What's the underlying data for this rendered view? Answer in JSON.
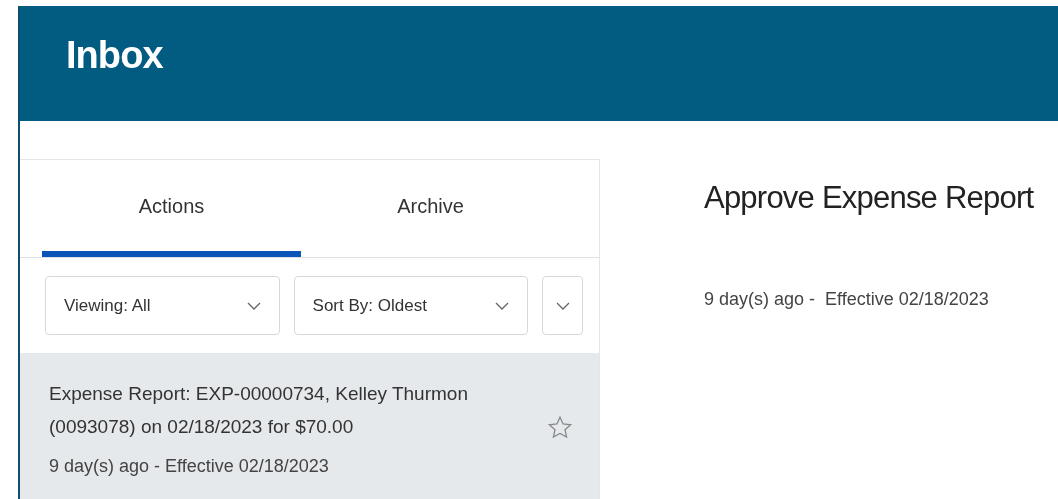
{
  "header": {
    "title": "Inbox"
  },
  "tabs": [
    {
      "label": "Actions",
      "selected": true
    },
    {
      "label": "Archive",
      "selected": false
    }
  ],
  "filters": [
    {
      "value": "Viewing: All"
    },
    {
      "value": "Sort By: Oldest"
    }
  ],
  "items": [
    {
      "title": "Expense Report: EXP-00000734, Kelley Thurmon (0093078) on 02/18/2023 for $70.00",
      "meta": "9 day(s) ago - Effective 02/18/2023",
      "selected": true,
      "starred": false
    }
  ],
  "detail": {
    "title": "Approve Expense Report",
    "meta": "9 day(s) ago -  Effective 02/18/2023"
  }
}
